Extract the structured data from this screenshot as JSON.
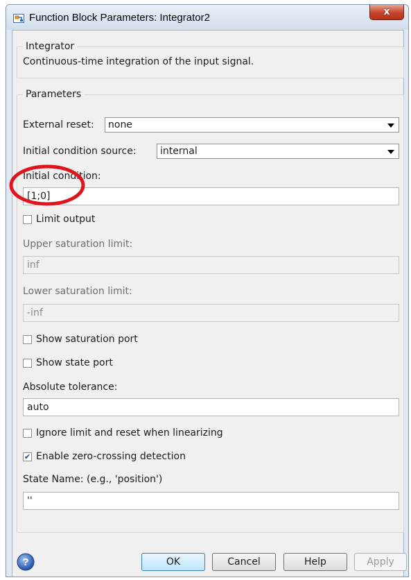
{
  "window": {
    "title": "Function Block Parameters: Integrator2",
    "close_glyph": "x"
  },
  "block": {
    "group_title": "Integrator",
    "description": "Continuous-time integration of the input signal."
  },
  "parameters": {
    "group_title": "Parameters",
    "external_reset": {
      "label": "External reset:",
      "value": "none"
    },
    "ic_source": {
      "label": "Initial condition source:",
      "value": "internal"
    },
    "initial_condition": {
      "label": "Initial condition:",
      "value": "[1;0]"
    },
    "limit_output": {
      "label": "Limit output",
      "checked": false
    },
    "upper_limit": {
      "label": "Upper saturation limit:",
      "value": "inf"
    },
    "lower_limit": {
      "label": "Lower saturation limit:",
      "value": "-inf"
    },
    "show_saturation_port": {
      "label": "Show saturation port",
      "checked": false
    },
    "show_state_port": {
      "label": "Show state port",
      "checked": false
    },
    "absolute_tolerance": {
      "label": "Absolute tolerance:",
      "value": "auto"
    },
    "ignore_limit": {
      "label": "Ignore limit and reset when linearizing",
      "checked": false
    },
    "zero_crossing": {
      "label": "Enable zero-crossing detection",
      "checked": true
    },
    "state_name": {
      "label": "State Name: (e.g., 'position')",
      "value": "''"
    }
  },
  "buttons": {
    "ok": "OK",
    "cancel": "Cancel",
    "help": "Help",
    "apply": "Apply"
  },
  "annotation": {
    "color": "#e0141c",
    "shape": "circle-highlight"
  },
  "icons": [
    "simulink-block-icon",
    "close-icon",
    "chevron-down-icon",
    "checkmark-icon",
    "help-icon"
  ]
}
